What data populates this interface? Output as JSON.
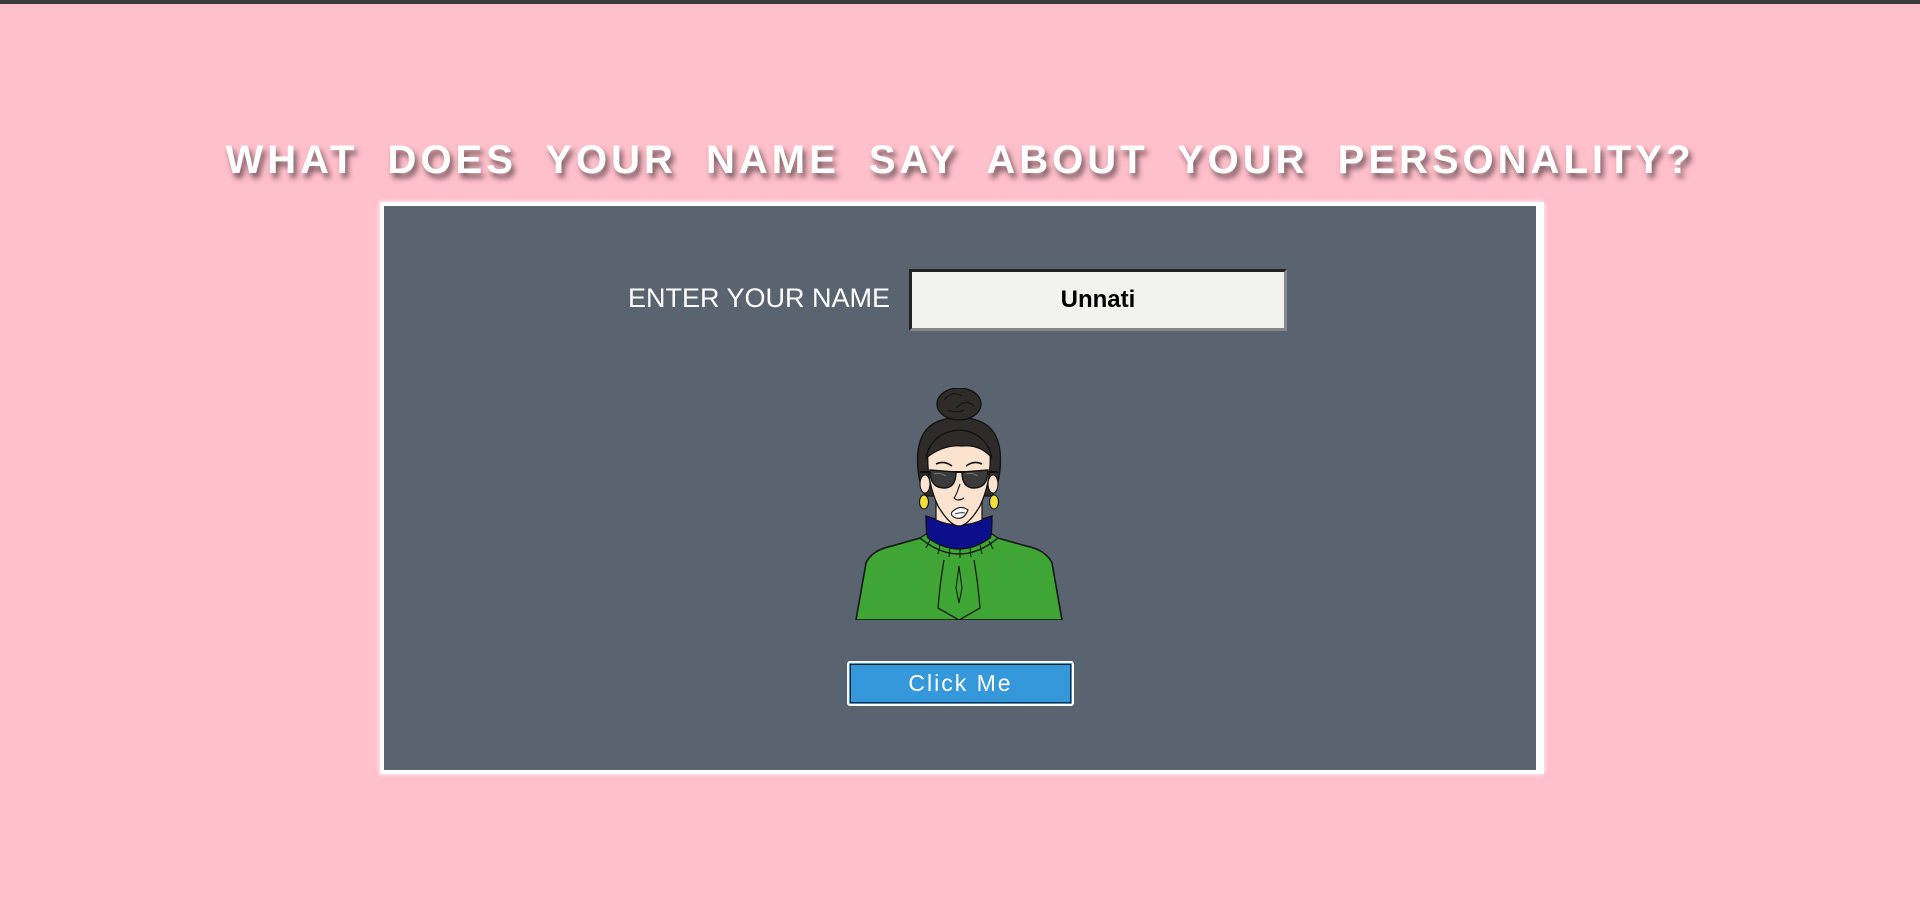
{
  "page": {
    "title": "WHAT DOES YOUR NAME SAY ABOUT YOUR PERSONALITY?"
  },
  "form": {
    "label": "ENTER YOUR NAME",
    "name_value": "Unnati",
    "button_label": "Click Me"
  },
  "colors": {
    "background": "#ffbfcb",
    "card_border": "#ffffff",
    "card_fill": "#5a6370",
    "button": "#3498db",
    "sweater": "#3fa535",
    "turtleneck": "#0b0f8c"
  },
  "icons": {
    "avatar": "woman-avatar-illustration"
  }
}
